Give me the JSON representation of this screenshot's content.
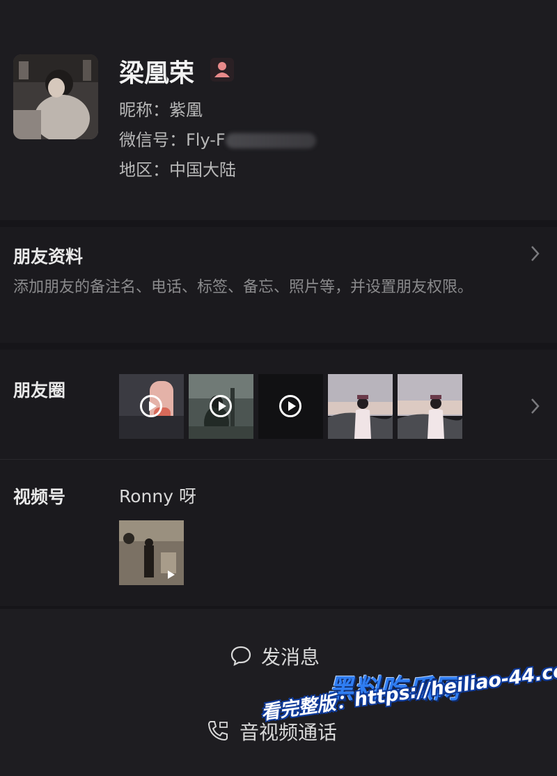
{
  "profile": {
    "name": "梁凰荣",
    "gender_icon": "person-female-icon",
    "nickname": "昵称：紫凰",
    "wechat_id": "微信号：Fly-F",
    "region": "地区：中国大陆"
  },
  "friend_info": {
    "title": "朋友资料",
    "description": "添加朋友的备注名、电话、标签、备忘、照片等，并设置朋友权限。"
  },
  "moments": {
    "title": "朋友圈",
    "thumbnails": [
      {
        "kind": "video"
      },
      {
        "kind": "video"
      },
      {
        "kind": "video"
      },
      {
        "kind": "photo"
      },
      {
        "kind": "photo"
      }
    ]
  },
  "channels": {
    "title": "视频号",
    "name": "Ronny 呀"
  },
  "actions": {
    "message": "发消息",
    "call": "音视频通话"
  },
  "watermark": {
    "title": "黑料吃瓜网",
    "url": "看完整版：https://heiliao-44.com"
  },
  "colors": {
    "background": "#1b1a1e",
    "accent_watermark": "#2f7df2",
    "gender_icon": "#e88a8a"
  }
}
